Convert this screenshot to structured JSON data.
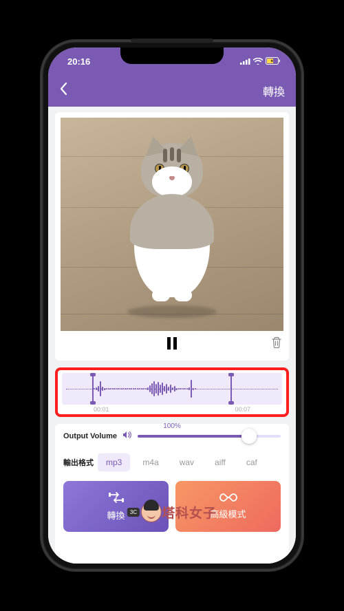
{
  "statusBar": {
    "time": "20:16",
    "signal_icon": "signal-icon",
    "wifi_icon": "wifi-icon",
    "battery_icon": "battery-charging-icon"
  },
  "navBar": {
    "back_icon": "chevron-left-icon",
    "title": "轉換"
  },
  "player": {
    "state": "playing",
    "pause_icon": "pause-icon",
    "delete_icon": "trash-icon"
  },
  "waveform": {
    "start_time": "00:01",
    "end_time": "00:07"
  },
  "volume": {
    "label": "Output Volume",
    "icon": "speaker-icon",
    "percent": "100%",
    "value": 100
  },
  "format": {
    "label": "輸出格式",
    "options": [
      "mp3",
      "m4a",
      "wav",
      "aiff",
      "caf"
    ],
    "selected": "mp3"
  },
  "actions": {
    "convert": {
      "icon": "convert-icon",
      "label": "轉換"
    },
    "advanced": {
      "icon": "infinity-icon",
      "label": "高級模式"
    }
  },
  "watermark": {
    "badge": "3C",
    "text": "塔科女子"
  },
  "colors": {
    "accent": "#7a5ab3",
    "highlight_border": "#ff1e1e",
    "advanced_gradient_from": "#f79764",
    "advanced_gradient_to": "#ee6a5f"
  }
}
